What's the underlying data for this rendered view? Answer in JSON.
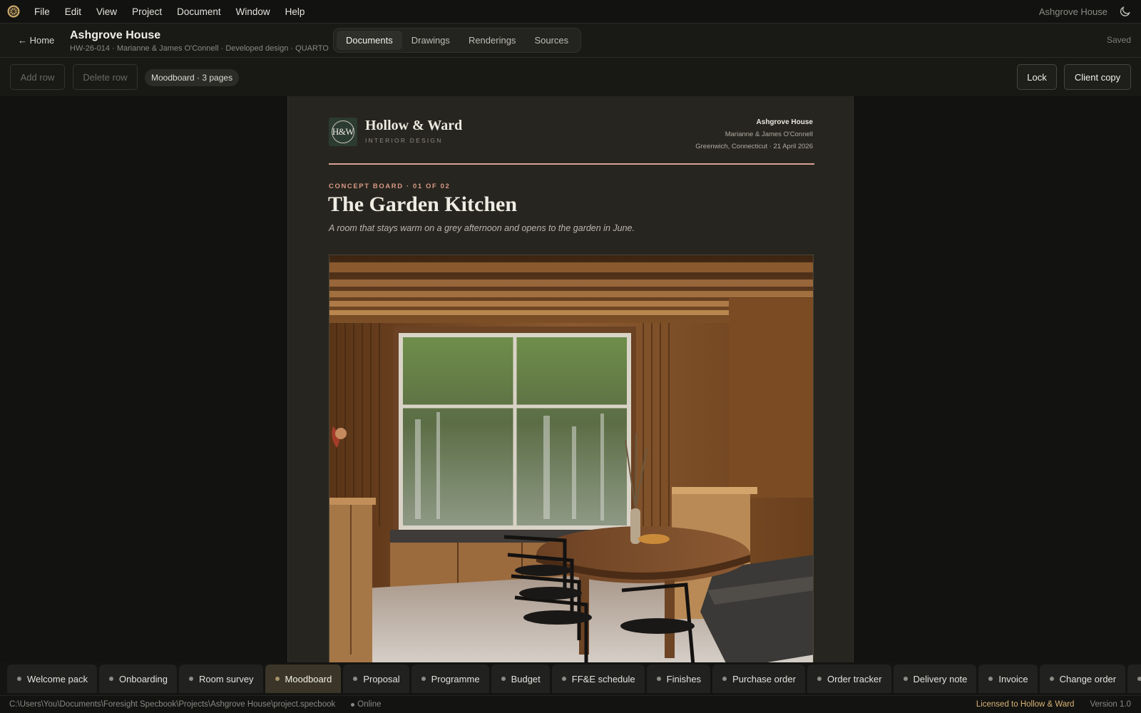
{
  "menubar": {
    "items": [
      "File",
      "Edit",
      "View",
      "Project",
      "Document",
      "Window",
      "Help"
    ],
    "window_title": "Ashgrove House"
  },
  "header": {
    "home_label": "← Home",
    "project_title": "Ashgrove House",
    "project_sub": "HW-26-014 · Marianne & James O'Connell · Developed design · QUARTO",
    "tabs": [
      {
        "label": "Documents",
        "active": true
      },
      {
        "label": "Drawings",
        "active": false
      },
      {
        "label": "Renderings",
        "active": false
      },
      {
        "label": "Sources",
        "active": false
      }
    ],
    "status": "Saved"
  },
  "toolbar": {
    "add_row": "Add row",
    "delete_row": "Delete row",
    "doc_pill": "Moodboard · 3 pages",
    "lock": "Lock",
    "client_copy": "Client copy"
  },
  "document": {
    "monogram": "H&W",
    "brand_name": "Hollow & Ward",
    "brand_tag": "INTERIOR DESIGN",
    "meta_project": "Ashgrove House",
    "meta_client": "Marianne & James O'Connell",
    "meta_place_date": "Greenwich, Connecticut · 21 April 2026",
    "kicker": "CONCEPT BOARD · 01 OF 02",
    "title": "The Garden Kitchen",
    "lede": "A room that stays warm on a grey afternoon and opens to the garden in June."
  },
  "doc_tabs": [
    {
      "label": "Welcome pack",
      "active": false
    },
    {
      "label": "Onboarding",
      "active": false
    },
    {
      "label": "Room survey",
      "active": false
    },
    {
      "label": "Moodboard",
      "active": true
    },
    {
      "label": "Proposal",
      "active": false
    },
    {
      "label": "Programme",
      "active": false
    },
    {
      "label": "Budget",
      "active": false
    },
    {
      "label": "FF&E schedule",
      "active": false
    },
    {
      "label": "Finishes",
      "active": false
    },
    {
      "label": "Purchase order",
      "active": false
    },
    {
      "label": "Order tracker",
      "active": false
    },
    {
      "label": "Delivery note",
      "active": false
    },
    {
      "label": "Invoice",
      "active": false
    },
    {
      "label": "Change order",
      "active": false
    },
    {
      "label": "",
      "active": false
    }
  ],
  "statusbar": {
    "path": "C:\\Users\\You\\Documents\\Foresight Specbook\\Projects\\Ashgrove House\\project.specbook",
    "online": "Online",
    "license": "Licensed to Hollow & Ward",
    "version": "Version 1.0"
  },
  "icons": {
    "app": "app-logo-icon",
    "theme": "moon-icon",
    "status": "dot-icon"
  },
  "colors": {
    "accent_rule": "#d8a095",
    "kicker": "#d79a86",
    "license": "#d9b475",
    "active_tab": "#3a3528"
  }
}
